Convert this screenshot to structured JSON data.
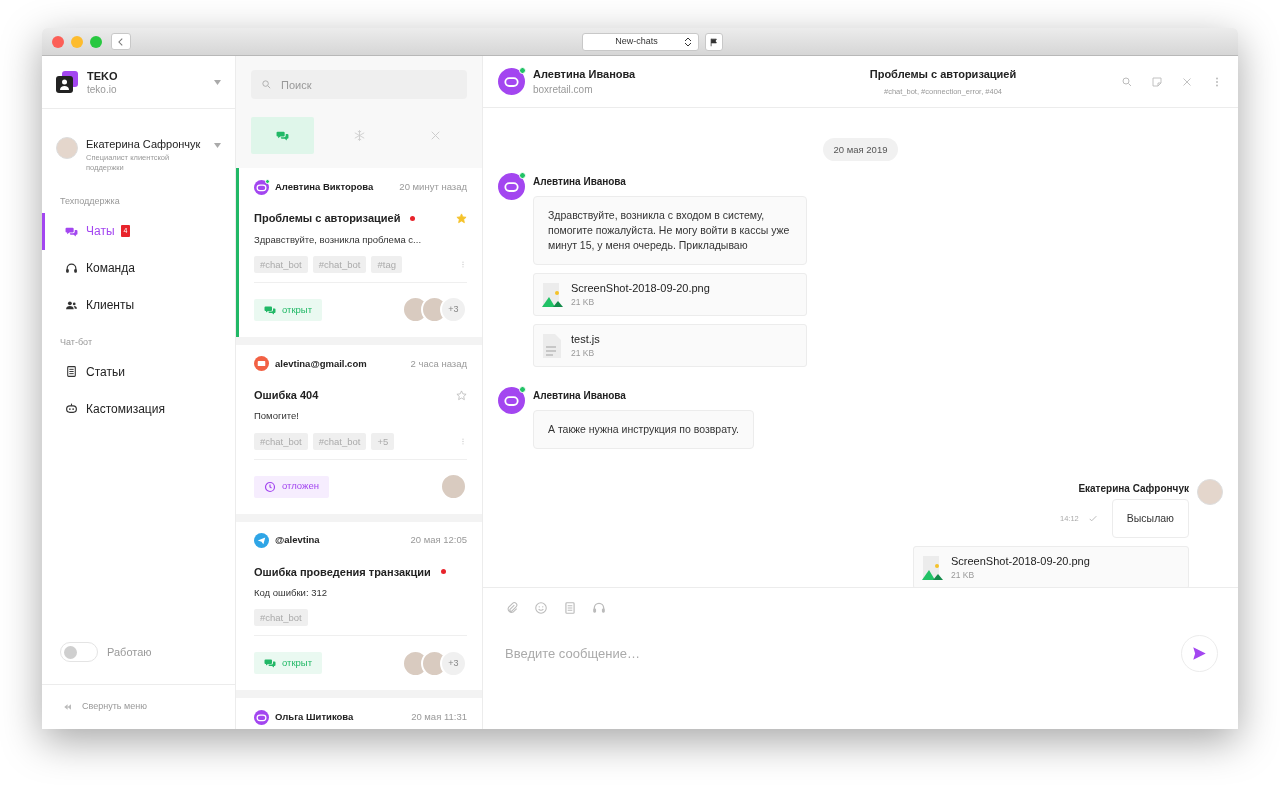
{
  "window": {
    "address": "New-chats"
  },
  "workspace": {
    "name": "TEKO",
    "domain": "teko.io"
  },
  "user": {
    "name": "Екатерина Сафрончук",
    "role": "Специалист клиентской поддержки"
  },
  "nav_sections": [
    {
      "title": "Техподдержка",
      "items": [
        {
          "label": "Чаты",
          "kind": "chats",
          "selected": true,
          "badge": "4"
        },
        {
          "label": "Команда",
          "kind": "headset",
          "selected": false
        },
        {
          "label": "Клиенты",
          "kind": "people",
          "selected": false
        }
      ]
    },
    {
      "title": "Чат-бот",
      "items": [
        {
          "label": "Статьи",
          "kind": "doc",
          "selected": false
        },
        {
          "label": "Кастомизация",
          "kind": "bot",
          "selected": false
        }
      ]
    }
  ],
  "status_toggle": {
    "label": "Работаю",
    "on": false
  },
  "collapse": {
    "label": "Свернуть меню"
  },
  "search": {
    "placeholder": "Поиск"
  },
  "filters": [
    {
      "kind": "chats",
      "selected": true
    },
    {
      "kind": "snowflake",
      "selected": false
    },
    {
      "kind": "close",
      "selected": false
    }
  ],
  "conversations": [
    {
      "kind": "bot",
      "online": true,
      "name": "Алевтина Викторова",
      "time": "20 минут назад",
      "subject": "Проблемы с авторизацией",
      "unread": true,
      "starred": true,
      "preview": "Здравствуйте, возникла проблема с...",
      "tags": [
        "#chat_bot",
        "#chat_bot",
        "#tag"
      ],
      "status": {
        "kind": "open",
        "label": "открыт"
      },
      "assignees": [
        {
          "kind": "photo"
        },
        {
          "kind": "photo"
        },
        {
          "kind": "more",
          "label": "+3"
        }
      ],
      "selected": true
    },
    {
      "kind": "email",
      "online": false,
      "name": "alevtina@gmail.com",
      "time": "2 часа назад",
      "subject": "Ошибка 404",
      "unread": false,
      "starred": false,
      "preview": "Помогите!",
      "tags": [
        "#chat_bot",
        "#chat_bot",
        "+5"
      ],
      "status": {
        "kind": "postponed",
        "label": "отложен"
      },
      "assignees": [
        {
          "kind": "photo"
        }
      ],
      "selected": false
    },
    {
      "kind": "telegram",
      "online": false,
      "name": "@alevtina",
      "time": "20 мая 12:05",
      "subject": "Ошибка проведения транзакции",
      "unread": true,
      "preview": "Код ошибки: 312",
      "tags": [
        "#chat_bot"
      ],
      "status": {
        "kind": "open",
        "label": "открыт"
      },
      "assignees": [
        {
          "kind": "photo"
        },
        {
          "kind": "photo"
        },
        {
          "kind": "more",
          "label": "+3"
        }
      ],
      "selected": false
    },
    {
      "kind": "bot",
      "online": false,
      "name": "Ольга Шитикова",
      "time": "20 мая 11:31",
      "selected": false
    }
  ],
  "chat": {
    "contact": {
      "name": "Алевтина Иванова",
      "domain": "boxretail.com",
      "online": true
    },
    "subject": "Проблемы с авторизацией",
    "tags": "#chat_bot, #connection_error, #404",
    "actions": [
      {
        "kind": "search"
      },
      {
        "kind": "note"
      },
      {
        "kind": "close"
      },
      {
        "kind": "more"
      }
    ],
    "date": "20 мая 2019",
    "messages": [
      {
        "kind": "incoming",
        "author": "Алевтина Иванова",
        "online": true,
        "items": [
          {
            "kind": "text",
            "text": "Здравствуйте, возникла с входом в систему, помогите пожалуйста. Не могу войти в кассы уже минут 15, у меня очередь. Прикладываю"
          },
          {
            "kind": "image_file",
            "name": "ScreenShot-2018-09-20.png",
            "size": "21 KB"
          },
          {
            "kind": "code_file",
            "name": "test.js",
            "size": "21 KB"
          }
        ]
      },
      {
        "kind": "incoming",
        "author": "Алевтина Иванова",
        "online": true,
        "items": [
          {
            "kind": "text",
            "text": "А также нужна инструкция по возврату."
          }
        ]
      },
      {
        "kind": "outgoing",
        "author": "Екатерина Сафрончук",
        "items": [
          {
            "kind": "text",
            "text": "Высылаю",
            "time": "14:12",
            "delivered": true
          },
          {
            "kind": "image_file",
            "name": "ScreenShot-2018-09-20.png",
            "size": "21 KB"
          }
        ]
      }
    ]
  },
  "composer": {
    "tools": [
      {
        "kind": "clip"
      },
      {
        "kind": "smile"
      },
      {
        "kind": "doc"
      },
      {
        "kind": "headset"
      }
    ],
    "placeholder": "Введите сообщение…"
  }
}
